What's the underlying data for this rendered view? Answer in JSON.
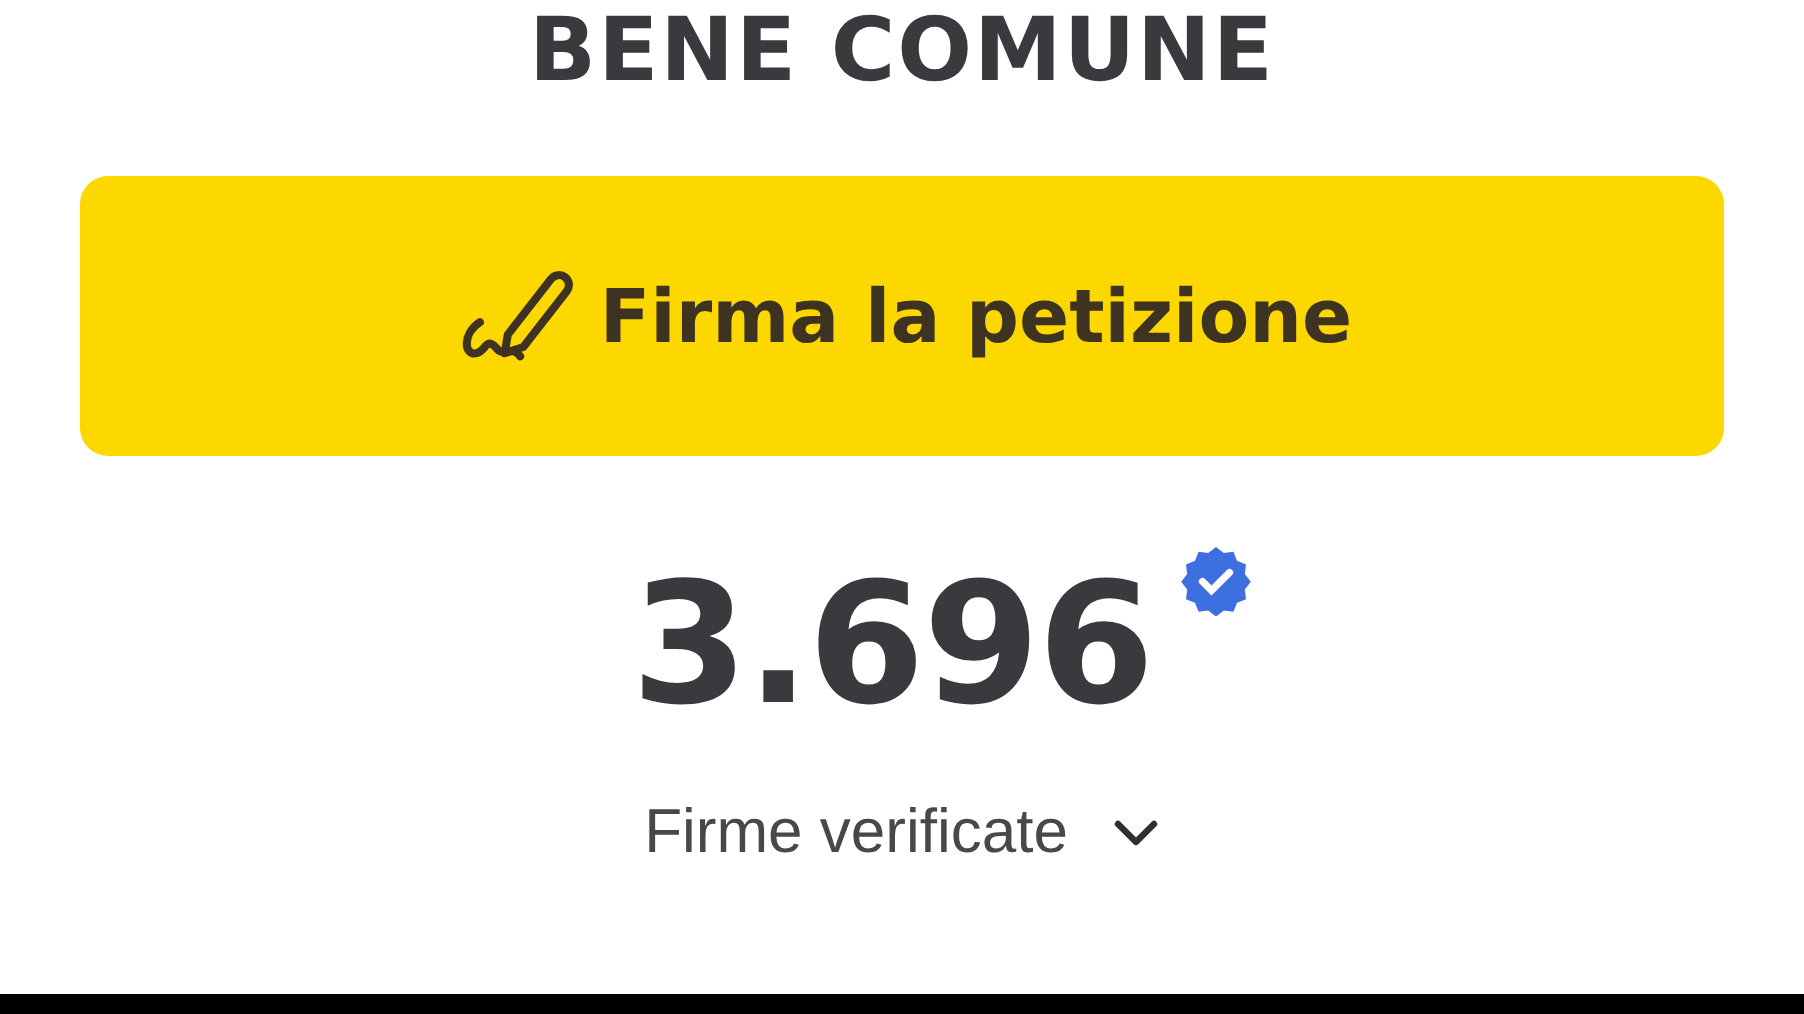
{
  "title": "BENE COMUNE",
  "sign_button": {
    "label": "Firma la petizione"
  },
  "signatures": {
    "count": "3.696",
    "verified": true,
    "label": "Firme verificate",
    "expanded": false
  }
}
